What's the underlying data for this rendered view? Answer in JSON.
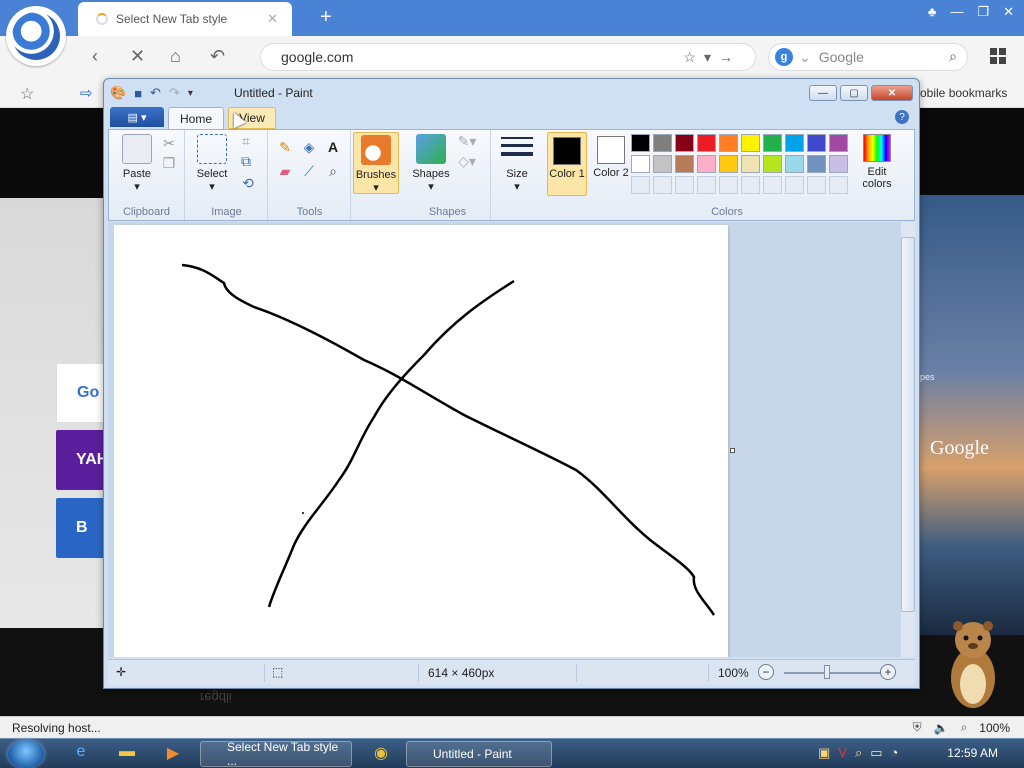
{
  "browser": {
    "tab_title": "Select New Tab style",
    "address": "google.com",
    "search_placeholder": "Google",
    "search_engine_letter": "g",
    "mobile_bookmarks": "obile bookmarks",
    "status_text": "Resolving host...",
    "zoom": "100%"
  },
  "ntp": {
    "google_label": "Google",
    "tiles": [
      "Go",
      "YAH",
      "B"
    ],
    "side_label": "pes",
    "reflection": "regdli"
  },
  "paint": {
    "title": "Untitled - Paint",
    "file_menu_icon": "paint-menu-icon",
    "tabs": {
      "home": "Home",
      "view": "View"
    },
    "groups": {
      "clipboard": "Clipboard",
      "image": "Image",
      "tools": "Tools",
      "shapes": "Shapes",
      "colors": "Colors"
    },
    "buttons": {
      "paste": "Paste",
      "select": "Select",
      "brushes": "Brushes",
      "shapes": "Shapes",
      "size": "Size",
      "color1": "Color 1",
      "color2": "Color 2",
      "edit_colors": "Edit colors"
    },
    "palette_row1": [
      "#000000",
      "#7f7f7f",
      "#880015",
      "#ed1c24",
      "#ff7f27",
      "#fff200",
      "#22b14c",
      "#00a2e8",
      "#3f48cc",
      "#a349a4"
    ],
    "palette_row2": [
      "#ffffff",
      "#c3c3c3",
      "#b97a57",
      "#ffaec9",
      "#ffc90e",
      "#efe4b0",
      "#b5e61d",
      "#99d9ea",
      "#7092be",
      "#c8bfe7"
    ],
    "color1_value": "#000000",
    "color2_value": "#ffffff",
    "status": {
      "dimensions": "614 × 460px",
      "zoom": "100%"
    }
  },
  "taskbar": {
    "tasks": [
      "Select New Tab style ...",
      "Untitled - Paint"
    ],
    "time": "12:59 AM"
  }
}
